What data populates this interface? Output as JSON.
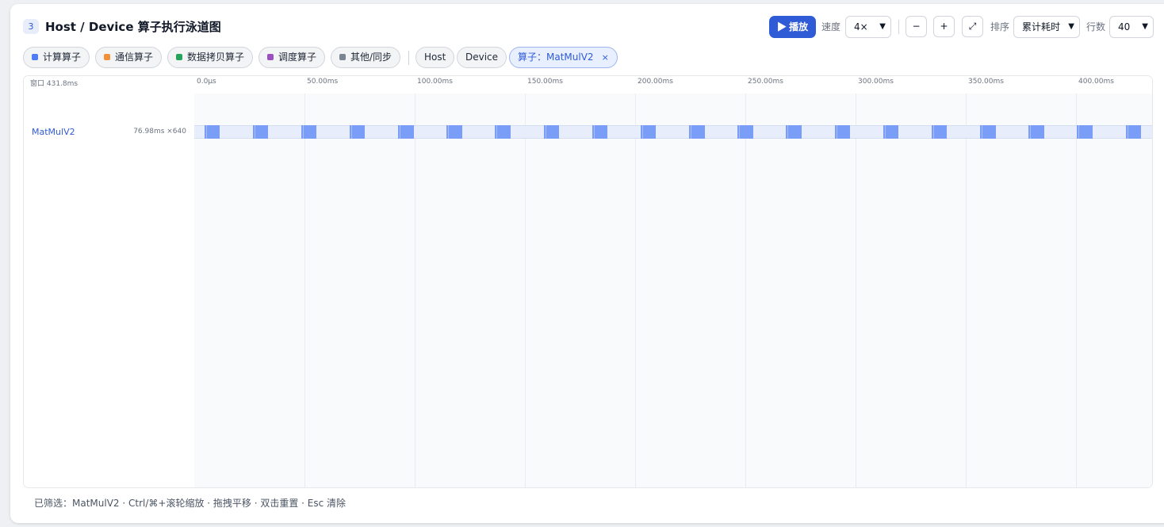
{
  "header": {
    "badge": "3",
    "title": "Host / Device 算子执行泳道图"
  },
  "toolbar": {
    "play_label": "▶ 播放",
    "speed_label": "速度",
    "speed_value": "4×",
    "zoom_out": "−",
    "zoom_in": "+",
    "fit": "⤢",
    "sort_label": "排序",
    "sort_value": "累计耗时",
    "rows_label": "行数",
    "rows_value": "40"
  },
  "filters": {
    "categories": [
      {
        "label": "计算算子",
        "color": "#4f7df3"
      },
      {
        "label": "通信算子",
        "color": "#f0913a"
      },
      {
        "label": "数据拷贝算子",
        "color": "#27a35a"
      },
      {
        "label": "调度算子",
        "color": "#9b4fc0"
      },
      {
        "label": "其他/同步",
        "color": "#7b8592"
      }
    ],
    "host": "Host",
    "device": "Device",
    "active_filter": "算子：MatMulV2",
    "clear_icon": "×"
  },
  "timeline": {
    "window_label": "窗口 431.8ms",
    "ticks": [
      "0.0μs",
      "50.00ms",
      "100.00ms",
      "150.00ms",
      "200.00ms",
      "250.00ms",
      "300.00ms",
      "350.00ms",
      "400.00ms"
    ],
    "tick_values_ms": [
      0,
      50,
      100,
      150,
      200,
      250,
      300,
      350,
      400
    ],
    "window_ms": 431.8,
    "lanes": [
      {
        "name": "MatMulV2",
        "stat": "76.98ms ×640",
        "color": "#7a9df7",
        "segments_ms": [
          [
            4.5,
            11.5
          ],
          [
            26.5,
            33.5
          ],
          [
            48.5,
            55.5
          ],
          [
            70.5,
            77.5
          ],
          [
            92.5,
            99.5
          ],
          [
            114.5,
            121.5
          ],
          [
            136.5,
            143.5
          ],
          [
            158.5,
            165.5
          ],
          [
            180.5,
            187.5
          ],
          [
            202.5,
            209.5
          ],
          [
            224.5,
            231.5
          ],
          [
            246.5,
            253.5
          ],
          [
            268.5,
            275.5
          ],
          [
            290.5,
            297.5
          ],
          [
            312.5,
            319.5
          ],
          [
            334.5,
            341.5
          ],
          [
            356.5,
            363.5
          ],
          [
            378.5,
            385.5
          ],
          [
            400.5,
            407.5
          ],
          [
            422.5,
            429.5
          ]
        ]
      }
    ]
  },
  "footer": "已筛选：MatMulV2 · Ctrl/⌘+滚轮缩放 · 拖拽平移 · 双击重置 · Esc 清除"
}
